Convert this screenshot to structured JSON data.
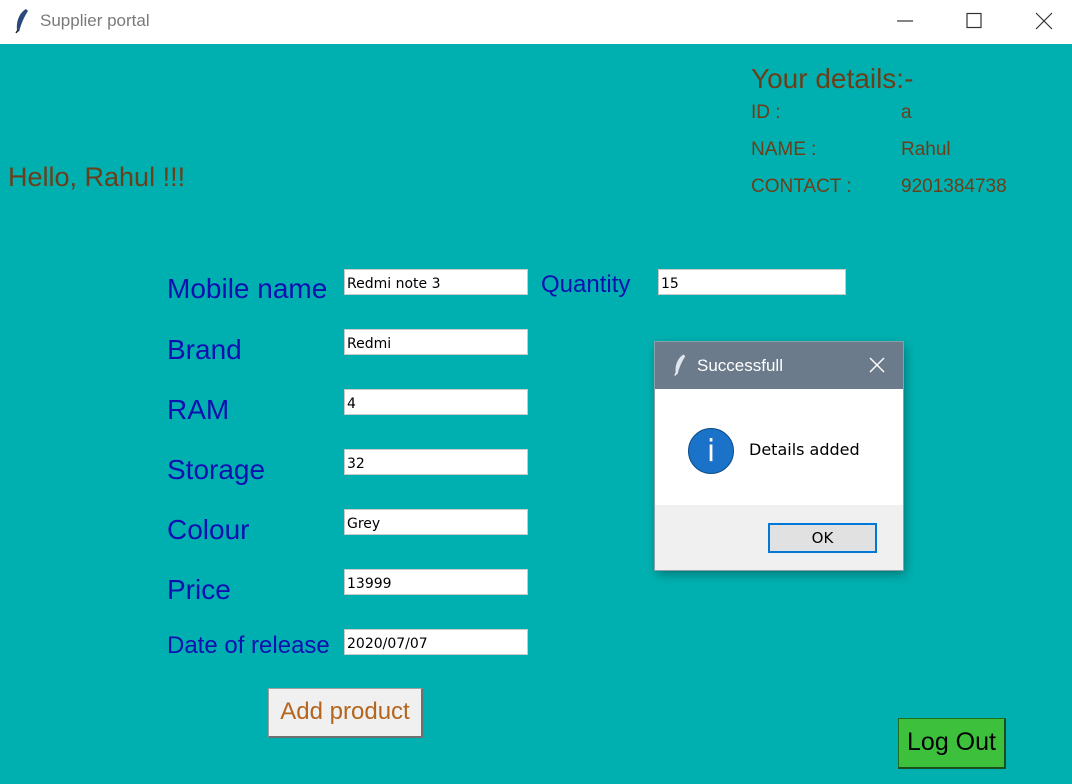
{
  "window": {
    "title": "Supplier portal"
  },
  "greeting": "Hello, Rahul !!!",
  "details": {
    "title": "Your details:-",
    "rows": [
      {
        "label": "ID :",
        "value": "a"
      },
      {
        "label": "NAME :",
        "value": "Rahul"
      },
      {
        "label": "CONTACT :",
        "value": "9201384738"
      }
    ]
  },
  "form": {
    "mobile_name": {
      "label": "Mobile name",
      "value": "Redmi note 3"
    },
    "quantity": {
      "label": "Quantity",
      "value": "15"
    },
    "brand": {
      "label": "Brand",
      "value": "Redmi"
    },
    "ram": {
      "label": "RAM",
      "value": "4"
    },
    "storage": {
      "label": "Storage",
      "value": "32"
    },
    "colour": {
      "label": "Colour",
      "value": "Grey"
    },
    "price": {
      "label": "Price",
      "value": "13999"
    },
    "release_date": {
      "label": "Date of release",
      "value": "2020/07/07"
    },
    "add_button": "Add product"
  },
  "logout_button": "Log Out",
  "dialog": {
    "title": "Successfull",
    "message": "Details added",
    "ok_label": "OK",
    "icon": "info-icon"
  },
  "colors": {
    "background": "#00b0b0",
    "label_blue": "#1010b0",
    "details_brown": "#6b3e1a",
    "logout_green": "#3dc13d"
  }
}
